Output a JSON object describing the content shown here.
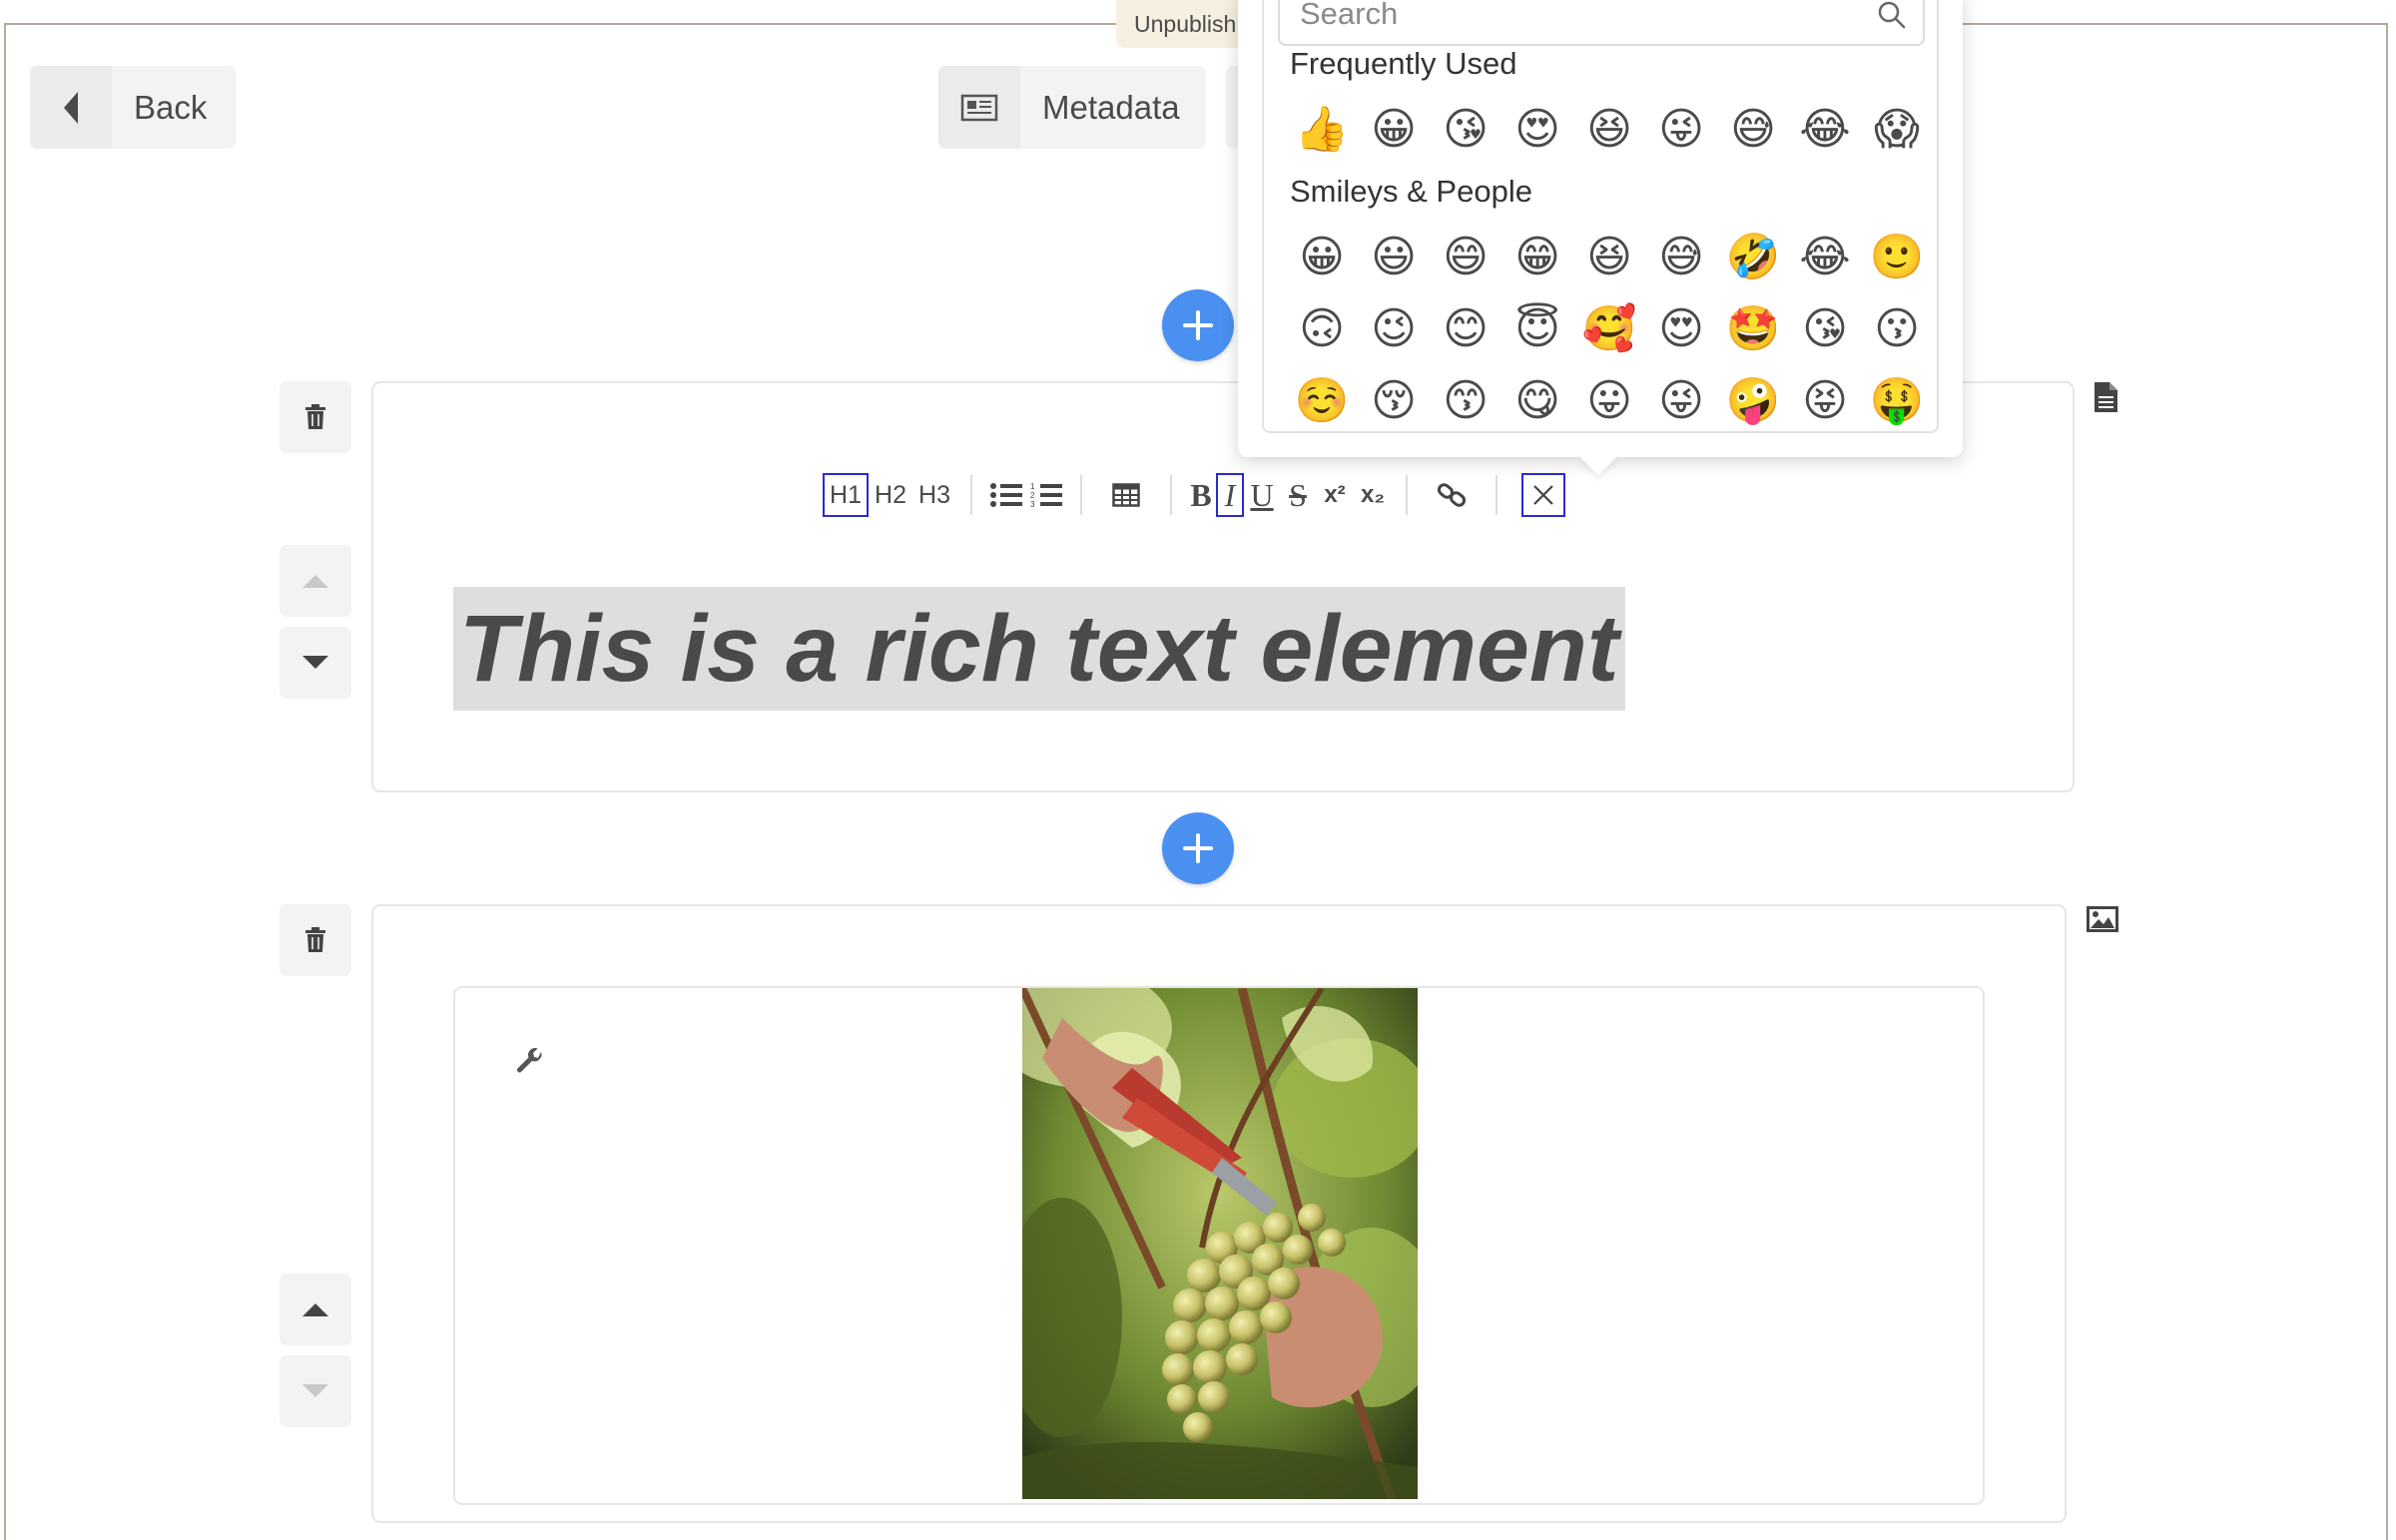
{
  "header": {
    "status_tag": "Unpublish",
    "back_label": "Back",
    "metadata_label": "Metadata"
  },
  "toolbar": {
    "h1": "H1",
    "h2": "H2",
    "h3": "H3",
    "bold": "B",
    "italic": "I",
    "underline": "U",
    "strike": "S",
    "superscript": "x²",
    "subscript": "x₂"
  },
  "blocks": {
    "text_block": {
      "content": "This is a rich text element",
      "type_icon": "document-icon"
    },
    "image_block": {
      "type_icon": "image-icon"
    }
  },
  "emoji_picker": {
    "search_placeholder": "Search",
    "categories": [
      {
        "name": "Frequently Used",
        "rows": [
          [
            "👍",
            "😀",
            "😘",
            "😍",
            "😆",
            "😜",
            "😅",
            "😂",
            "😱"
          ]
        ]
      },
      {
        "name": "Smileys & People",
        "rows": [
          [
            "😀",
            "😃",
            "😄",
            "😁",
            "😆",
            "😅",
            "🤣",
            "😂",
            "🙂"
          ],
          [
            "🙃",
            "😉",
            "😊",
            "😇",
            "🥰",
            "😍",
            "🤩",
            "😘",
            "😗"
          ],
          [
            "☺️",
            "😚",
            "😙",
            "😋",
            "😛",
            "😜",
            "🤪",
            "😝",
            "🤑"
          ]
        ]
      }
    ]
  },
  "colors": {
    "accent_blue": "#4a90f0",
    "active_outline": "#2a2ad0",
    "frame_border": "#b5aa9b",
    "status_tag_bg": "#f7efdf"
  }
}
